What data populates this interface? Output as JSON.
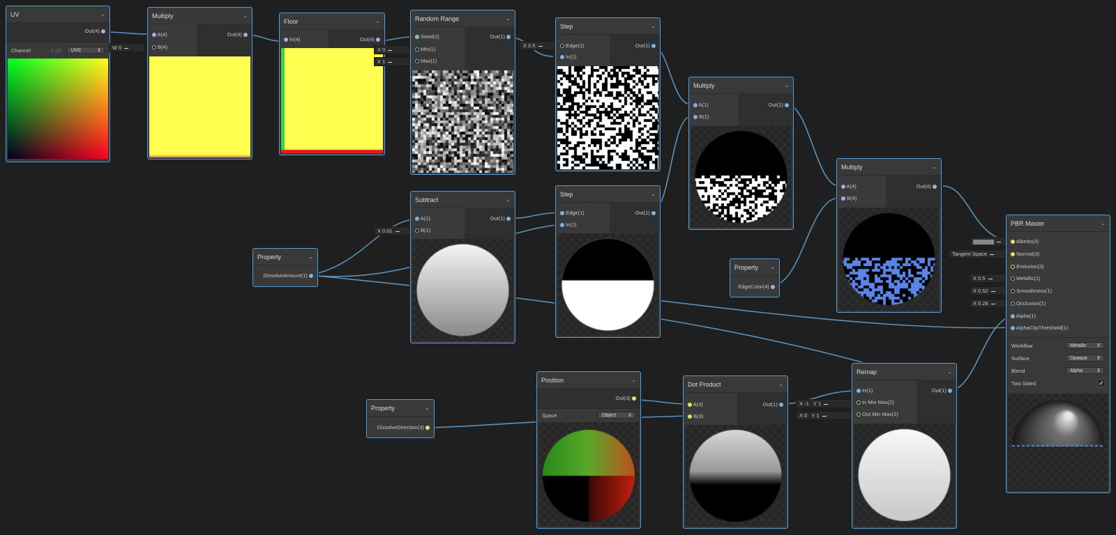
{
  "nodes": {
    "uv": {
      "title": "UV",
      "out": "Out(4)",
      "channel_label": "Channel",
      "channel_hint": "X (4)",
      "channel_value": "UV0"
    },
    "multiply1": {
      "title": "Multiply",
      "a": "A(4)",
      "b": "B(4)",
      "out": "Out(4)",
      "b_input": "W 0"
    },
    "floor": {
      "title": "Floor",
      "in": "In(4)",
      "out": "Out(4)"
    },
    "random_range": {
      "title": "Random Range",
      "seed": "Seed(2)",
      "min": "Min(1)",
      "max": "Max(1)",
      "out": "Out(1)",
      "min_input": "X 0",
      "max_input": "X 1"
    },
    "step1": {
      "title": "Step",
      "edge": "Edge(1)",
      "in": "In(1)",
      "out": "Out(1)",
      "edge_input": "X 0.5"
    },
    "multiply2": {
      "title": "Multiply",
      "a": "A(1)",
      "b": "B(1)",
      "out": "Out(1)"
    },
    "multiply3": {
      "title": "Multiply",
      "a": "A(4)",
      "b": "B(4)",
      "out": "Out(4)"
    },
    "subtract": {
      "title": "Subtract",
      "a": "A(1)",
      "b": "B(1)",
      "out": "Out(1)",
      "b_input": "X 0.01"
    },
    "step2": {
      "title": "Step",
      "edge": "Edge(1)",
      "in": "In(1)",
      "out": "Out(1)"
    },
    "prop_amount": {
      "title": "Property",
      "out": "DissolveAmount(1)"
    },
    "prop_edgecolor": {
      "title": "Property",
      "out": "EdgeColor(4)"
    },
    "prop_direction": {
      "title": "Property",
      "out": "DissolveDirection(3)"
    },
    "position": {
      "title": "Position",
      "out": "Out(3)",
      "space_label": "Space",
      "space_value": "Object"
    },
    "dot_product": {
      "title": "Dot Product",
      "a": "A(3)",
      "b": "B(3)",
      "out": "Out(1)"
    },
    "remap": {
      "title": "Remap",
      "in": "In(1)",
      "in_minmax": "In Min Max(2)",
      "out_minmax": "Out Min Max(2)",
      "out": "Out(1)",
      "in_x": "X -1",
      "in_y": "Y 1",
      "out_x": "X 0",
      "out_y": "Y 1"
    },
    "pbr": {
      "title": "PBR Master",
      "inputs": [
        "Albedo(3)",
        "Normal(3)",
        "Emission(3)",
        "Metallic(1)",
        "Smoothness(1)",
        "Occlusion(1)",
        "Alpha(1)",
        "AlphaClipThreshold(1)"
      ],
      "normal_input": "Tangent Space",
      "metallic_input": "X 0.5",
      "smoothness_input": "X 0.52",
      "occlusion_input": "X 0.28",
      "settings": [
        {
          "label": "Workflow",
          "value": "Metallic"
        },
        {
          "label": "Surface",
          "value": "Opaque"
        },
        {
          "label": "Blend",
          "value": "Alpha"
        }
      ],
      "two_sided_label": "Two Sided",
      "two_sided_checked": "✓"
    }
  },
  "colors": {
    "background": "#1f1f1f",
    "node_border": "#5b9bd5",
    "wire": "#5993bd",
    "edge_color": "#5b84e6",
    "preview_yellow": "#ffff50"
  }
}
